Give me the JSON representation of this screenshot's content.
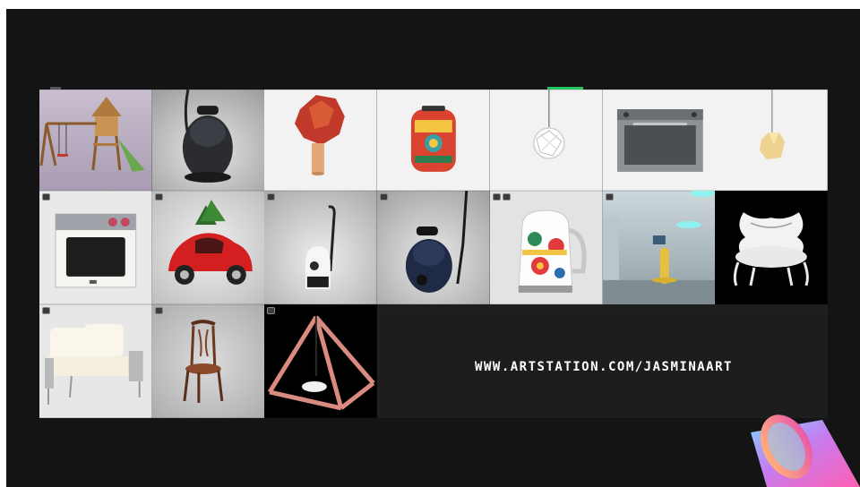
{
  "website": "WWW.ARTSTATION.COM/JASMINAART",
  "tiles": [
    {
      "name": "playground-swing-set-thumbnail",
      "icon": "wooden-playground-icon"
    },
    {
      "name": "black-vacuum-cleaner-thumbnail",
      "icon": "vacuum-cleaner-icon"
    },
    {
      "name": "red-glass-lamp-thumbnail",
      "icon": "table-lamp-icon"
    },
    {
      "name": "decorated-toaster-thumbnail",
      "icon": "toaster-icon"
    },
    {
      "name": "crystal-pendant-lamp-thumbnail",
      "icon": "pendant-lamp-icon"
    },
    {
      "name": "built-in-oven-thumbnail",
      "icon": "oven-icon"
    },
    {
      "name": "gold-pendant-lamp-thumbnail",
      "icon": "pendant-lamp-icon"
    },
    {
      "name": "white-oven-thumbnail",
      "icon": "oven-icon"
    },
    {
      "name": "red-beetle-car-thumbnail",
      "icon": "car-icon"
    },
    {
      "name": "white-vacuum-cleaner-thumbnail",
      "icon": "vacuum-cleaner-icon"
    },
    {
      "name": "navy-vacuum-cleaner-thumbnail",
      "icon": "vacuum-cleaner-icon"
    },
    {
      "name": "decorated-kettle-thumbnail",
      "icon": "kettle-icon"
    },
    {
      "name": "futuristic-interior-thumbnail",
      "icon": "room-interior-icon"
    },
    {
      "name": "white-baroque-chair-thumbnail",
      "icon": "armchair-icon"
    },
    {
      "name": "outdoor-sofa-thumbnail",
      "icon": "sofa-icon"
    },
    {
      "name": "wooden-chair-thumbnail",
      "icon": "chair-icon"
    },
    {
      "name": "pyramid-frame-thumbnail",
      "icon": "pyramid-icon"
    }
  ],
  "colors": {
    "background": "#141414",
    "accent_green": "#22c55e",
    "text": "#ffffff"
  }
}
